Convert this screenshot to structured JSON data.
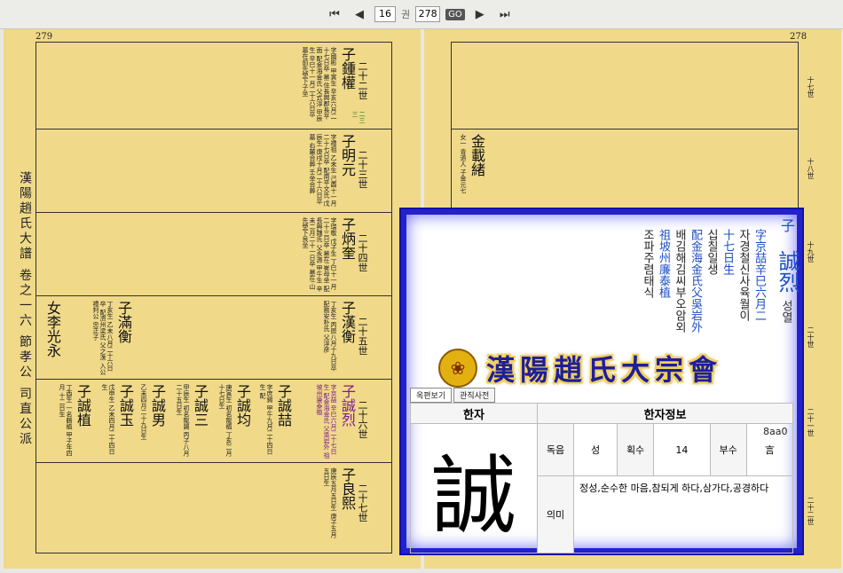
{
  "toolbar": {
    "first_icon": "⏮",
    "prev_icon": "◀",
    "page_current": "16",
    "page_sep": "권",
    "page_total": "278",
    "go_label": "GO",
    "next_icon": "▶",
    "last_icon": "⏭"
  },
  "left_page": {
    "page_number": "279",
    "title": "漢陽趙氏大譜 卷之一六 節孝公 司直公派",
    "rows": [
      {
        "gen": "二十二世",
        "entries": [
          {
            "name": "子鍾權",
            "hangul": "종권",
            "extra": "二三三",
            "note": "字國彬 甲寅生 辛亥六月二十七日卒 墓 住長興郡長平面 配金海金氏 父式淳 甲辰生 辛巳十一月二十六日卒 墓在前先塋下子坐"
          }
        ]
      },
      {
        "gen": "二十三世",
        "entries": [
          {
            "name": "子明元",
            "hangul": "명원",
            "note": "字禮祖 乙未生 己酉十一月二十七日卒 配南平文氏 戊辰生 庚戌十月二十六日卒 墓 右麓合葬 壬坐合葬",
            "child": "一子"
          }
        ]
      },
      {
        "gen": "二十四世",
        "entries": [
          {
            "name": "子炳奎",
            "hangul": "병규",
            "note": "字瑞敬 戊子生 丁巳十一月二十三日卒 墓在 崔母坐 配長興魏氏 父永源 甲午生 辛未二月二十一日卒 墓在 山先塋下艮坐",
            "child": "一女"
          }
        ]
      },
      {
        "gen": "二十五世",
        "entries": [
          {
            "name": "子漢衡",
            "hangul": "한형",
            "note": "丁亥生 丙辰八月十九日卒 配務安朴氏 父淳彦",
            "child": "二子"
          },
          {
            "name": "子滿衡",
            "hangul": "만형",
            "note": "丁亥生 乙未八月二十六日卒 配濟州梁氏 父之洙 入公禮判公 忠正子",
            "child": "二女"
          },
          {
            "name": "女李光永",
            "hangul": "",
            "note": "",
            "child": ""
          }
        ]
      },
      {
        "gen": "二十六世",
        "entries": [
          {
            "name": "子誠烈",
            "hangul": "성열",
            "note": "字京喆 辛巳六月二十七日生 配金海金氏 父吳岩外 祖坡州廉泰植",
            "child": "一子"
          },
          {
            "name": "子誠喆",
            "hangul": "성철",
            "note": "字庶錫 甲午九月二十四日生 配"
          },
          {
            "name": "子誠均",
            "hangul": "성균",
            "note": "庚寅生 初名龍植 丁亥二月十七日生"
          },
          {
            "name": "子誠三",
            "hangul": "성삼",
            "note": "甲辰生 初名龍錫 丙子八月二十五日生"
          },
          {
            "name": "子誠男",
            "hangul": "성남",
            "note": "乙未四月二十九日生"
          },
          {
            "name": "子誠玉",
            "hangul": "성옥",
            "note": "戊申生 乙未四月二十四日生"
          },
          {
            "name": "子誠植",
            "hangul": "성식",
            "note": "丁酉生 一名鶴植 甲子年四月 十二日生"
          }
        ]
      },
      {
        "gen": "二十七世",
        "entries": [
          {
            "name": "子良熙",
            "hangul": "양희",
            "note": "庚辰五月五日生 庚子五月五日生"
          }
        ]
      }
    ]
  },
  "right_page": {
    "page_number": "278",
    "generations": [
      "十七世",
      "十八世",
      "十九世",
      "二十世",
      "二十一世",
      "二十二世"
    ],
    "entry": {
      "name": "金載緒",
      "note": "女一 青道人 子金元七"
    }
  },
  "popup": {
    "person_label": "子",
    "person_name": "誠烈",
    "person_hangul": "성열",
    "col1": "字京喆辛巳六月二",
    "col1_hangul": "자경철신사육월이",
    "col2": "十七日生",
    "col2_hangul": "십칠일생",
    "col3": "配金海金氏父吳岩外",
    "col3_hangul": "배김해김씨부오암외",
    "col4": "祖坡州廉泰植",
    "col4_hangul": "조파주렴태식",
    "banner": "漢陽趙氏大宗會",
    "seal": "❀",
    "tab_dict": "옥편보기",
    "tab_related": "관직사전",
    "table": {
      "header_hanja": "한자",
      "header_info": "한자정보",
      "char": "誠",
      "row1": {
        "label_sound": "독음",
        "sound": "성",
        "label_strokes": "획수",
        "strokes": "14",
        "label_radical": "부수",
        "radical": "言",
        "code": "8aa0"
      },
      "label_meaning": "의미",
      "meaning": "정성,순수한 마음,참되게 하다,삼가다,공경하다"
    }
  }
}
